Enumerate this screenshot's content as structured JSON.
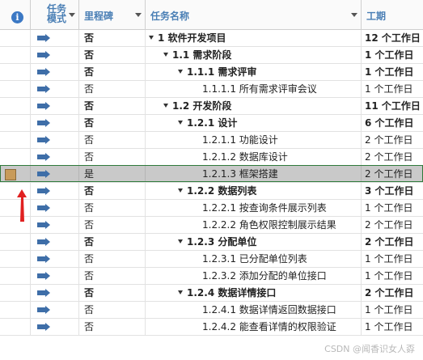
{
  "header": {
    "indicator_icon": "info-icon",
    "mode_label_line1": "任务",
    "mode_label_line2": "模式",
    "milestone_label": "里程碑",
    "name_label": "任务名称",
    "duration_label": "工期"
  },
  "rows": [
    {
      "milestone": "否",
      "name": "1 软件开发项目",
      "duration": "12 个工作日"
    },
    {
      "milestone": "否",
      "name": "1.1 需求阶段",
      "duration": "1 个工作日"
    },
    {
      "milestone": "否",
      "name": "1.1.1 需求评审",
      "duration": "1 个工作日"
    },
    {
      "milestone": "否",
      "name": "1.1.1.1 所有需求评审会议",
      "duration": "1 个工作日"
    },
    {
      "milestone": "否",
      "name": "1.2 开发阶段",
      "duration": "11 个工作日"
    },
    {
      "milestone": "否",
      "name": "1.2.1 设计",
      "duration": "6 个工作日"
    },
    {
      "milestone": "否",
      "name": "1.2.1.1 功能设计",
      "duration": "2 个工作日"
    },
    {
      "milestone": "否",
      "name": "1.2.1.2 数据库设计",
      "duration": "2 个工作日"
    },
    {
      "milestone": "是",
      "name": "1.2.1.3 框架搭建",
      "duration": "2 个工作日",
      "indicator": "note-icon"
    },
    {
      "milestone": "否",
      "name": "1.2.2 数据列表",
      "duration": "3 个工作日"
    },
    {
      "milestone": "否",
      "name": "1.2.2.1 按查询条件展示列表",
      "duration": "1 个工作日"
    },
    {
      "milestone": "否",
      "name": "1.2.2.2 角色权限控制展示结果",
      "duration": "2 个工作日"
    },
    {
      "milestone": "否",
      "name": "1.2.3 分配单位",
      "duration": "2 个工作日"
    },
    {
      "milestone": "否",
      "name": "1.2.3.1 已分配单位列表",
      "duration": "1 个工作日"
    },
    {
      "milestone": "否",
      "name": "1.2.3.2 添加分配的单位接口",
      "duration": "1 个工作日"
    },
    {
      "milestone": "否",
      "name": "1.2.4 数据详情接口",
      "duration": "2 个工作日"
    },
    {
      "milestone": "否",
      "name": "1.2.4.1 数据详情返回数据接口",
      "duration": "1 个工作日"
    },
    {
      "milestone": "否",
      "name": "1.2.4.2 能查看详情的权限验证",
      "duration": "1 个工作日"
    }
  ],
  "annotation": {
    "arrow_color": "#e02020"
  },
  "watermark": "CSDN @闻香识女人孬",
  "colors": {
    "header_text": "#4a7fb5",
    "selection_border": "#2f7a3b",
    "selected_row": "#c9c9c9",
    "mode_icon": "#3e6ea8"
  }
}
